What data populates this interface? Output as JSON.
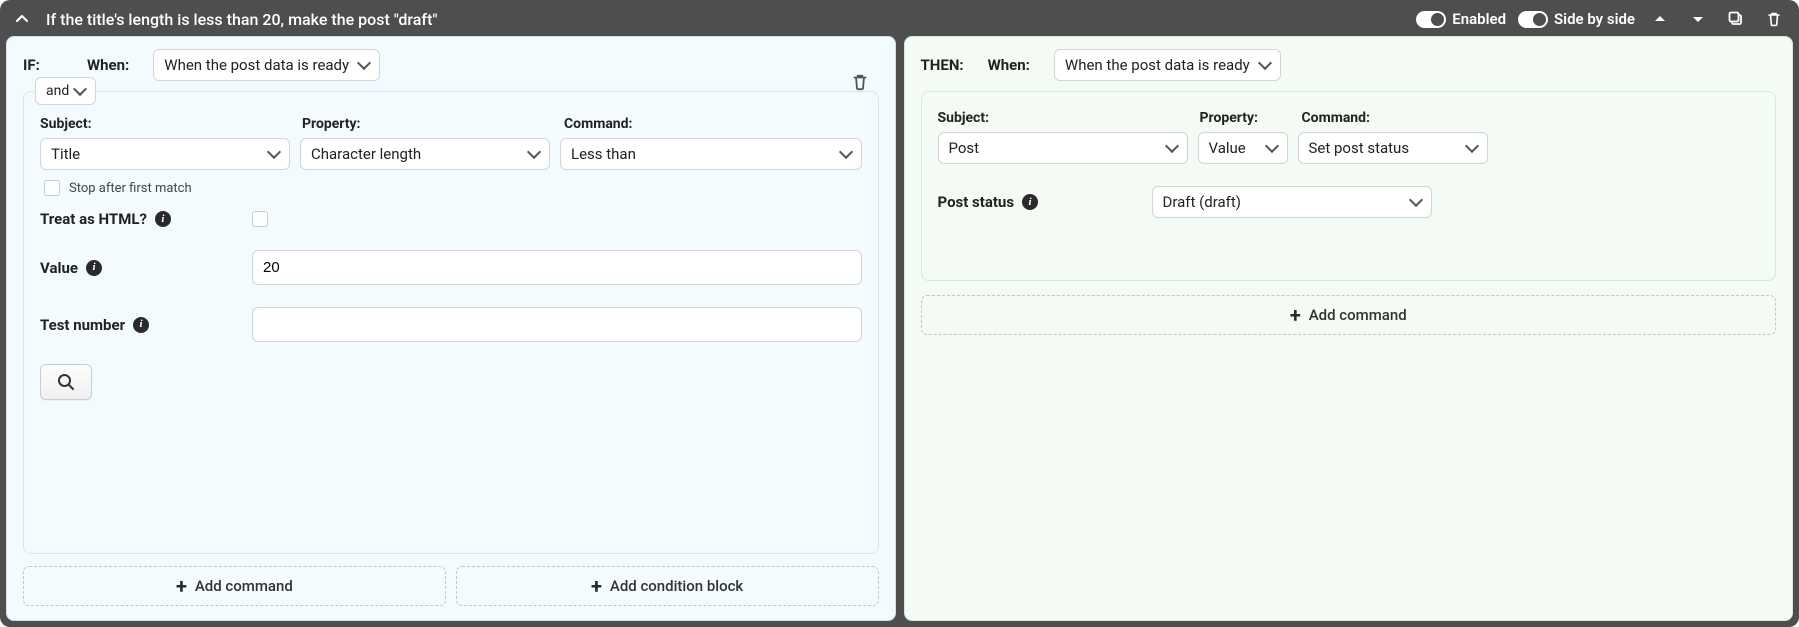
{
  "header": {
    "title": "If the title's length is less than 20, make the post \"draft\"",
    "enabled_label": "Enabled",
    "sidebyside_label": "Side by side"
  },
  "if": {
    "heading": "IF:",
    "when_label": "When:",
    "when_value": "When the post data is ready",
    "group_op": "and",
    "labels": {
      "subject": "Subject:",
      "property": "Property:",
      "command": "Command:"
    },
    "subject": "Title",
    "property": "Character length",
    "command": "Less than",
    "stop_after_first_match": "Stop after first match",
    "treat_as_html_label": "Treat as HTML?",
    "value_label": "Value",
    "value": "20",
    "test_number_label": "Test number",
    "test_number": "",
    "add_command": "Add command",
    "add_condition_block": "Add condition block"
  },
  "then": {
    "heading": "THEN:",
    "when_label": "When:",
    "when_value": "When the post data is ready",
    "labels": {
      "subject": "Subject:",
      "property": "Property:",
      "command": "Command:"
    },
    "subject": "Post",
    "property": "Value",
    "command": "Set post status",
    "post_status_label": "Post status",
    "post_status_value": "Draft (draft)",
    "add_command": "Add command"
  }
}
